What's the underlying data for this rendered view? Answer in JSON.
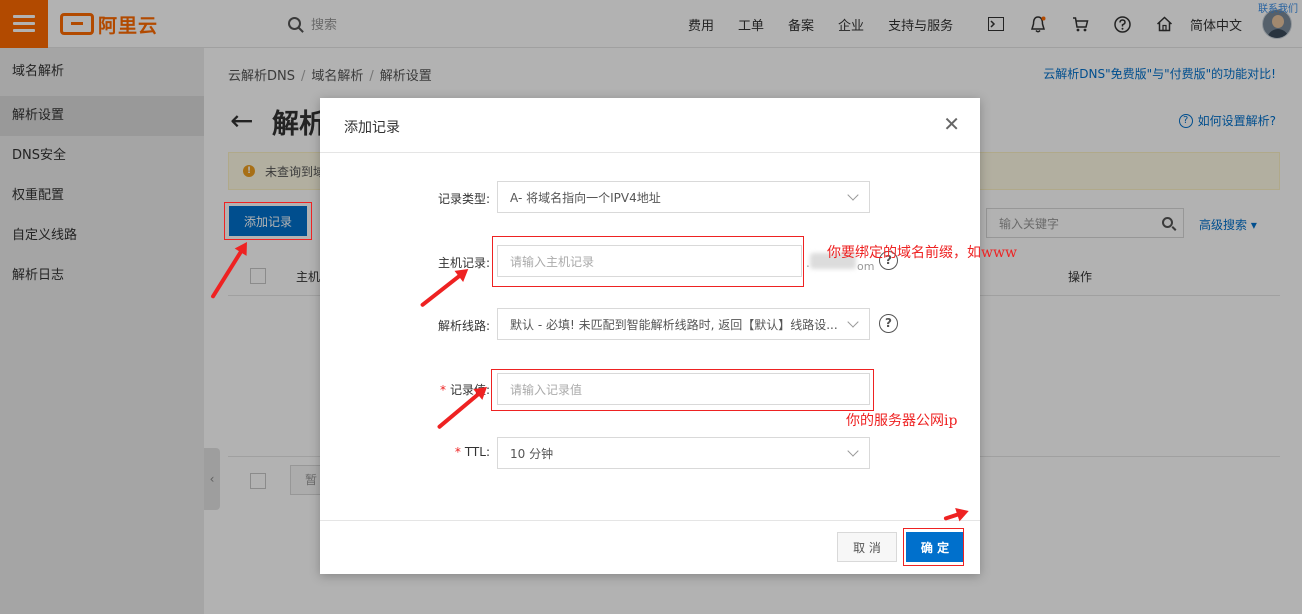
{
  "topbar": {
    "brand": "阿里云",
    "search_placeholder": "搜索",
    "nav": [
      "费用",
      "工单",
      "备案",
      "企业",
      "支持与服务"
    ],
    "language": "简体中文",
    "corner": "联系我们"
  },
  "sidebar": {
    "title": "域名解析",
    "items": [
      "解析设置",
      "DNS安全",
      "权重配置",
      "自定义线路",
      "解析日志"
    ],
    "active": "解析设置"
  },
  "main": {
    "breadcrumb": [
      "云解析DNS",
      "域名解析",
      "解析设置"
    ],
    "compare_link": "云解析DNS\"免费版\"与\"付费版\"的功能对比!",
    "page_title": "解析",
    "help_link": "如何设置解析?",
    "notice": "未查询到域",
    "add_button": "添加记录",
    "keyword_placeholder": "输入关键字",
    "advanced_search": "高级搜索",
    "table": {
      "col_host": "主机",
      "col_op": "操作"
    },
    "pause_button": "暂"
  },
  "dialog": {
    "title": "添加记录",
    "fields": {
      "record_type": {
        "label": "记录类型:",
        "value": "A- 将域名指向一个IPV4地址"
      },
      "host": {
        "label": "主机记录:",
        "placeholder": "请输入主机记录",
        "suffix": ".",
        "suffix_tail": "om"
      },
      "line": {
        "label": "解析线路:",
        "value": "默认 - 必填! 未匹配到智能解析线路时, 返回【默认】线路设..."
      },
      "value": {
        "label": "记录值:",
        "placeholder": "请输入记录值"
      },
      "ttl": {
        "label": "TTL:",
        "value": "10 分钟"
      }
    },
    "cancel": "取 消",
    "confirm": "确 定"
  },
  "annotations": {
    "host_note": "你要绑定的域名前缀，如www",
    "value_note": "你的服务器公网ip"
  },
  "colors": {
    "accent": "#ff6a00",
    "primary": "#0070cc",
    "annotation": "#e22222"
  }
}
